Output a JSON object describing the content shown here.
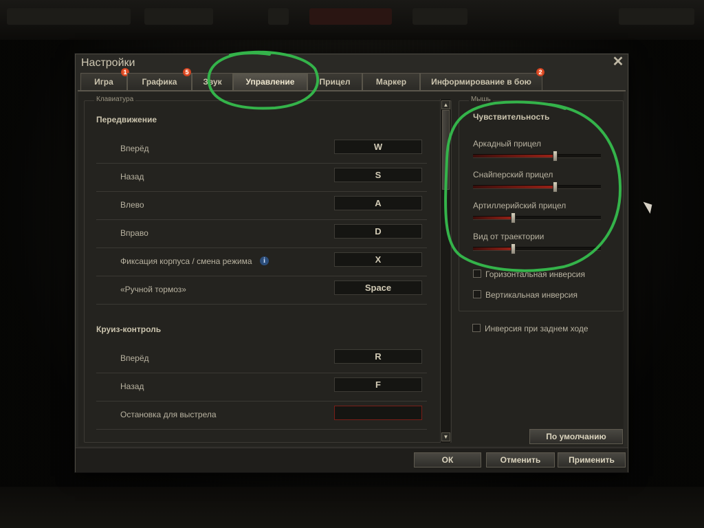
{
  "window": {
    "title": "Настройки",
    "close_glyph": "✕"
  },
  "tabs": [
    {
      "label": "Игра",
      "badge": "1"
    },
    {
      "label": "Графика",
      "badge": "5"
    },
    {
      "label": "Звук"
    },
    {
      "label": "Управление",
      "active": true
    },
    {
      "label": "Прицел"
    },
    {
      "label": "Маркер"
    },
    {
      "label": "Информирование в бою",
      "badge": "2"
    }
  ],
  "keyboard": {
    "legend": "Клавиатура",
    "movement": {
      "title": "Передвижение",
      "rows": [
        {
          "label": "Вперёд",
          "key": "W"
        },
        {
          "label": "Назад",
          "key": "S"
        },
        {
          "label": "Влево",
          "key": "A"
        },
        {
          "label": "Вправо",
          "key": "D"
        },
        {
          "label": "Фиксация корпуса / смена режима",
          "key": "X",
          "info": "i"
        },
        {
          "label": "«Ручной тормоз»",
          "key": "Space"
        }
      ]
    },
    "cruise": {
      "title": "Круиз-контроль",
      "rows": [
        {
          "label": "Вперёд",
          "key": "R"
        },
        {
          "label": "Назад",
          "key": "F"
        },
        {
          "label": "Остановка для выстрела",
          "key": ""
        }
      ]
    }
  },
  "mouse": {
    "legend": "Мышь",
    "sensitivity_title": "Чувствительность",
    "sliders": [
      {
        "label": "Аркадный прицел",
        "value": 0.64
      },
      {
        "label": "Снайперский прицел",
        "value": 0.64
      },
      {
        "label": "Артиллерийский прицел",
        "value": 0.31
      },
      {
        "label": "Вид от траектории",
        "value": 0.31
      }
    ],
    "checkboxes": [
      {
        "label": "Горизонтальная инверсия",
        "checked": false
      },
      {
        "label": "Вертикальная инверсия",
        "checked": false
      },
      {
        "label": "Инверсия при заднем ходе",
        "checked": false
      }
    ]
  },
  "buttons": {
    "default": "По умолчанию",
    "ok": "ОК",
    "cancel": "Отменить",
    "apply": "Применить"
  },
  "scrollbar": {
    "up": "▲",
    "down": "▼"
  },
  "colors": {
    "annotation": "#34b34a",
    "slider_fill": "#9a2217",
    "badge": "#d23a15"
  }
}
